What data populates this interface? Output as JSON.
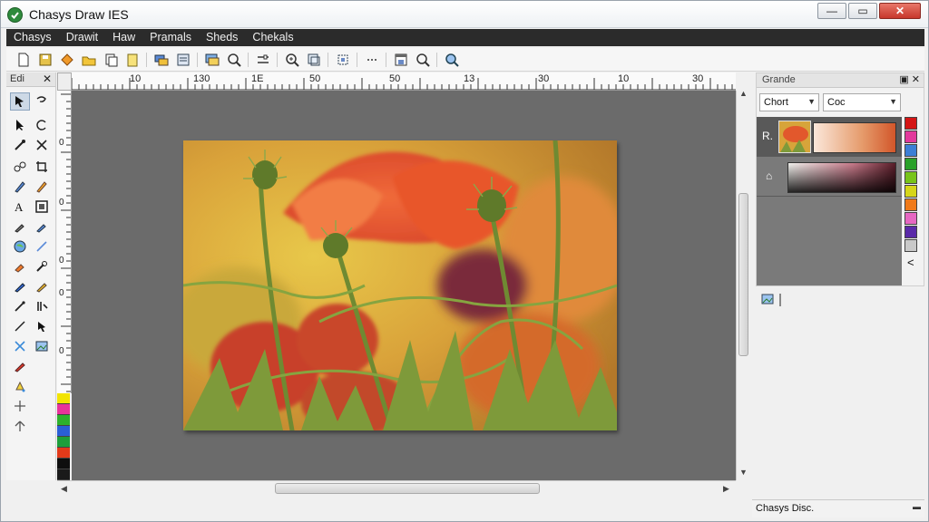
{
  "window": {
    "title": "Chasys Draw IES"
  },
  "menu": [
    "Chasys",
    "Drawit",
    "Haw",
    "Pramals",
    "Sheds",
    "Chekals"
  ],
  "toolbar": {
    "icons": [
      "new-document-icon",
      "save-icon",
      "paint-bucket-icon",
      "open-folder-icon",
      "copy-icon",
      "paste-icon",
      "layers-icon",
      "properties-icon",
      "frame-icon",
      "zoom-icon",
      "adjust-icon",
      "zoom-in-icon",
      "crop-icon",
      "transform-icon",
      "more-icon",
      "print-icon",
      "search-icon",
      "magnifier-icon"
    ]
  },
  "toolbox": {
    "label": "Edi",
    "close": "✕"
  },
  "ruler": {
    "top_labels": [
      "10",
      "130",
      "1E",
      "50",
      "50",
      "13",
      "30",
      "10",
      "30"
    ],
    "left_labels": [
      "0",
      "0",
      "0",
      "0",
      "0"
    ]
  },
  "panel": {
    "title": "Grande",
    "dropdown1": "Chort",
    "dropdown2": "Coc",
    "layer1_tag": "R.",
    "layer2_tag": "⌂",
    "swatch_colors": [
      "#d41616",
      "#e23a9c",
      "#3c7fd6",
      "#2aa12a",
      "#78c41a",
      "#d6d61a",
      "#f07a1a",
      "#e667c2",
      "#5a2aa8",
      "#c9c9c9"
    ],
    "collapse": "<"
  },
  "palette_colors": [
    "#f2e400",
    "#e8339a",
    "#2db12d",
    "#2a5fd6",
    "#1d9e3b",
    "#e23a1a",
    "#0e0e0e",
    "#1a1a1a"
  ],
  "status": {
    "text": "Chasys Disc."
  }
}
